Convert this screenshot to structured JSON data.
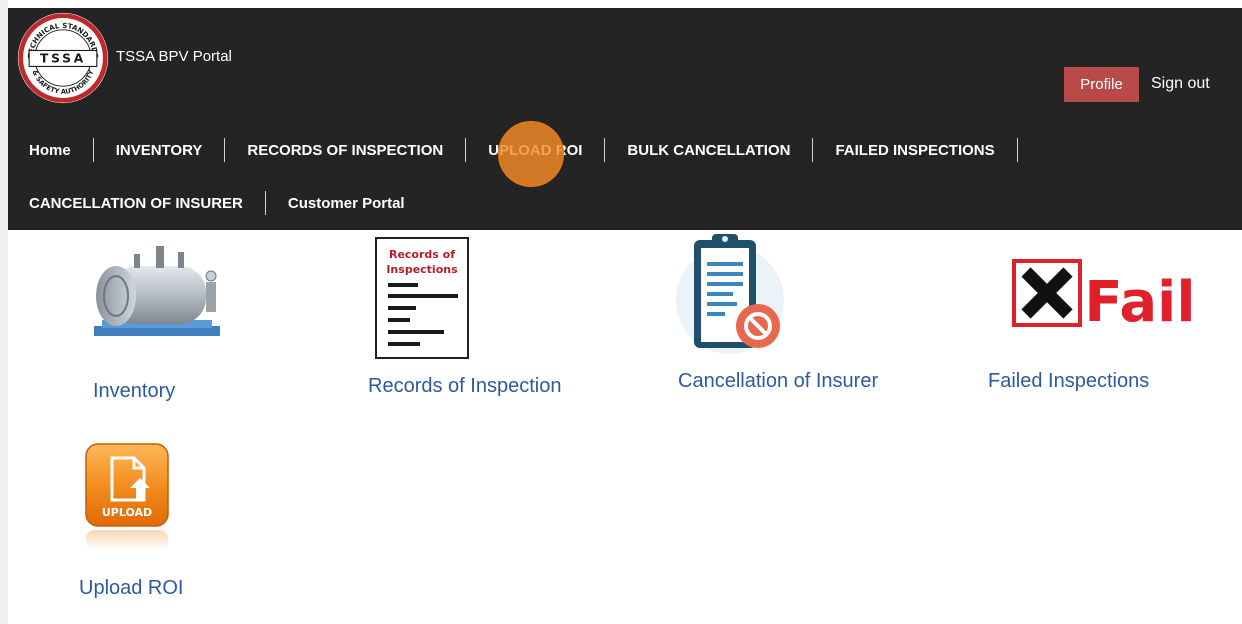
{
  "app": {
    "title": "TSSA BPV Portal"
  },
  "logo": {
    "top_text": "TECHNICAL STANDARDS",
    "center_text": "TSSA",
    "bottom_text": "& SAFETY AUTHORITY"
  },
  "header": {
    "profile_label": "Profile",
    "signout_label": "Sign out"
  },
  "nav": {
    "home": "Home",
    "inventory": "INVENTORY",
    "records": "RECORDS OF INSPECTION",
    "upload": "UPLOAD ROI",
    "bulk": "BULK CANCELLATION",
    "failed": "FAILED INSPECTIONS",
    "cancellation": "CANCELLATION OF INSURER",
    "customer": "Customer Portal"
  },
  "tiles": {
    "inventory": {
      "label": "Inventory"
    },
    "records": {
      "label": "Records of Inspection",
      "image_title": "Records of Inspections"
    },
    "cancellation": {
      "label": "Cancellation of Insurer"
    },
    "failed": {
      "label": "Failed Inspections",
      "image_text": "Fail"
    },
    "upload": {
      "label": "Upload ROI",
      "image_text": "UPLOAD"
    }
  },
  "colors": {
    "header_bg": "#242424",
    "profile_bg": "#b94a4a",
    "link": "#2d5a9e",
    "fail_red": "#e0202a",
    "upload_orange": "#f08a1c"
  }
}
